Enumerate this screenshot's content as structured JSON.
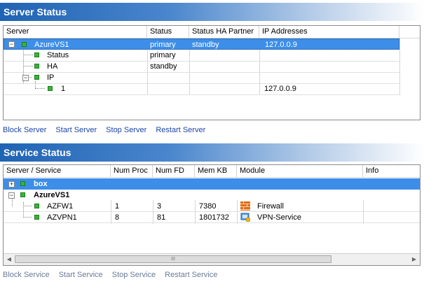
{
  "server_status": {
    "title": "Server Status",
    "columns": [
      "Server",
      "Status",
      "Status HA Partner",
      "IP Addresses"
    ],
    "rows": [
      {
        "name": "AzureVS1",
        "status": "primary",
        "ha": "standby",
        "ip": "127.0.0.9"
      },
      {
        "name": "Status",
        "status": "primary",
        "ha": "",
        "ip": ""
      },
      {
        "name": "HA",
        "status": "standby",
        "ha": "",
        "ip": ""
      },
      {
        "name": "IP",
        "status": "",
        "ha": "",
        "ip": ""
      },
      {
        "name": "1",
        "status": "",
        "ha": "",
        "ip": "127.0.0.9"
      }
    ],
    "actions": {
      "block": "Block Server",
      "start": "Start Server",
      "stop": "Stop Server",
      "restart": "Restart Server"
    }
  },
  "service_status": {
    "title": "Service Status",
    "columns": [
      "Server / Service",
      "Num Proc",
      "Num FD",
      "Mem KB",
      "Module",
      "Info"
    ],
    "rows": [
      {
        "name": "box",
        "proc": "",
        "fd": "",
        "mem": "",
        "module": ""
      },
      {
        "name": "AzureVS1",
        "proc": "",
        "fd": "",
        "mem": "",
        "module": ""
      },
      {
        "name": "AZFW1",
        "proc": "1",
        "fd": "3",
        "mem": "7380",
        "module": "Firewall"
      },
      {
        "name": "AZVPN1",
        "proc": "8",
        "fd": "81",
        "mem": "1801732",
        "module": "VPN-Service"
      }
    ],
    "actions": {
      "block": "Block Service",
      "start": "Start Service",
      "stop": "Stop Service",
      "restart": "Restart Service"
    },
    "scroll_thumb_glyph": "III",
    "icons": {
      "firewall": "firewall-module-icon",
      "vpn": "vpn-module-icon"
    }
  },
  "colors": {
    "header_start": "#1f63b3",
    "selection": "#3d8ee8",
    "node": "#3ab33a",
    "link": "#1b45a8"
  }
}
